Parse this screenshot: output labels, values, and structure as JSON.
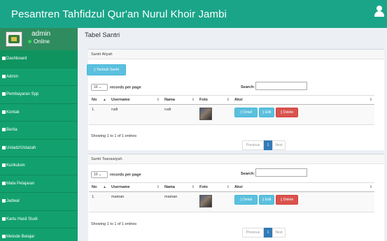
{
  "app": {
    "title": "Pesantren Tahfidzul Qur'an Nurul Khoir Jambi"
  },
  "user": {
    "name": "admin",
    "status": "Online"
  },
  "sidebar": {
    "items": [
      {
        "label": "Dashboard"
      },
      {
        "label": "Admin"
      },
      {
        "label": "Pembayaran Spp"
      },
      {
        "label": "Kontak"
      },
      {
        "label": "Berita"
      },
      {
        "label": "Ustadz/Ustazah"
      },
      {
        "label": "Kurikulum"
      },
      {
        "label": "Mata Pelajaran"
      },
      {
        "label": "Jadwal"
      },
      {
        "label": "Kartu Hasil Studi"
      },
      {
        "label": "Metode Belajar"
      }
    ]
  },
  "main": {
    "title": "Tabel Santri"
  },
  "aliyah": {
    "header": "Santri Aliyah",
    "add_button": "▯ Tambah Santri",
    "length_value": "10",
    "length_label": "records per page",
    "search_label": "Search:",
    "columns": [
      "No",
      "Username",
      "Nama",
      "Foto",
      "Aksi"
    ],
    "rows": [
      {
        "no": "1.",
        "username": "rudi",
        "nama": "rudi"
      }
    ],
    "info": "Showing 1 to 1 of 1 entries",
    "pager": {
      "prev": "Previous",
      "page": "1",
      "next": "Next"
    }
  },
  "tsanawiyah": {
    "header": "Santri Tsanawiyah",
    "length_value": "10",
    "length_label": "records per page",
    "search_label": "Search:",
    "columns": [
      "No",
      "Username",
      "Nama",
      "Foto",
      "Aksi"
    ],
    "rows": [
      {
        "no": "1.",
        "username": "maman",
        "nama": "maman"
      }
    ],
    "info": "Showing 1 to 1 of 1 entries",
    "pager": {
      "prev": "Previous",
      "page": "1",
      "next": "Next"
    }
  },
  "actions": {
    "detail": "▯ Detail",
    "edit": "▯ Edit",
    "delete": "▯ Delete"
  },
  "icons": {
    "user": "user-icon",
    "menu": "square-icon"
  },
  "colors": {
    "topbar": "#1aa589",
    "sidebar": "#12a16e",
    "info_button": "#5bc0de",
    "danger_button": "#d9534f",
    "pager_active": "#337ab7"
  }
}
